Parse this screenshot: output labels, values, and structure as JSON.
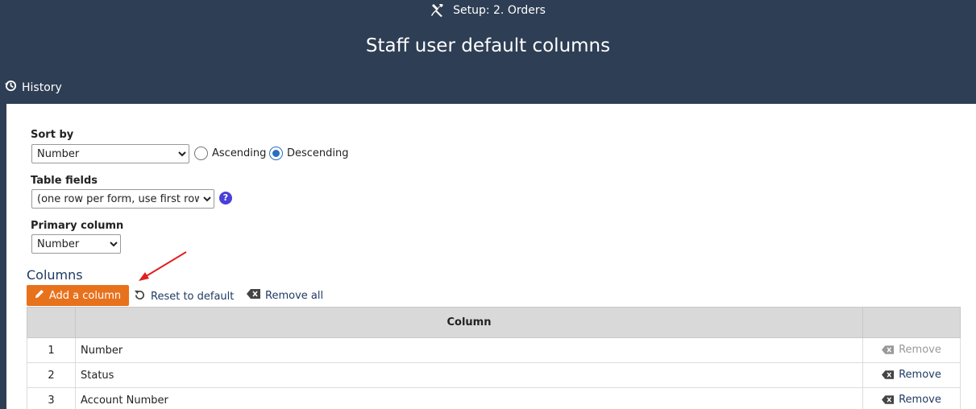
{
  "header": {
    "breadcrumb": "Setup: 2. Orders",
    "title": "Staff user default columns",
    "history_label": "History"
  },
  "form": {
    "sort_by": {
      "label": "Sort by",
      "selected": "Number",
      "ascending_label": "Ascending",
      "descending_label": "Descending",
      "direction": "descending"
    },
    "table_fields": {
      "label": "Table fields",
      "selected": "(one row per form, use first row)"
    },
    "primary_column": {
      "label": "Primary column",
      "selected": "Number"
    }
  },
  "columns": {
    "title": "Columns",
    "add_label": "Add a column",
    "reset_label": "Reset to default",
    "remove_all_label": "Remove all",
    "header_column": "Column",
    "remove_label": "Remove",
    "rows": [
      {
        "num": "1",
        "name": "Number",
        "removable": false
      },
      {
        "num": "2",
        "name": "Status",
        "removable": true
      },
      {
        "num": "3",
        "name": "Account Number",
        "removable": true
      }
    ]
  },
  "colors": {
    "header_bg": "#2e3e54",
    "accent_orange": "#e8711c",
    "link_blue": "#1f3a64",
    "annotation_red": "#e02020"
  }
}
